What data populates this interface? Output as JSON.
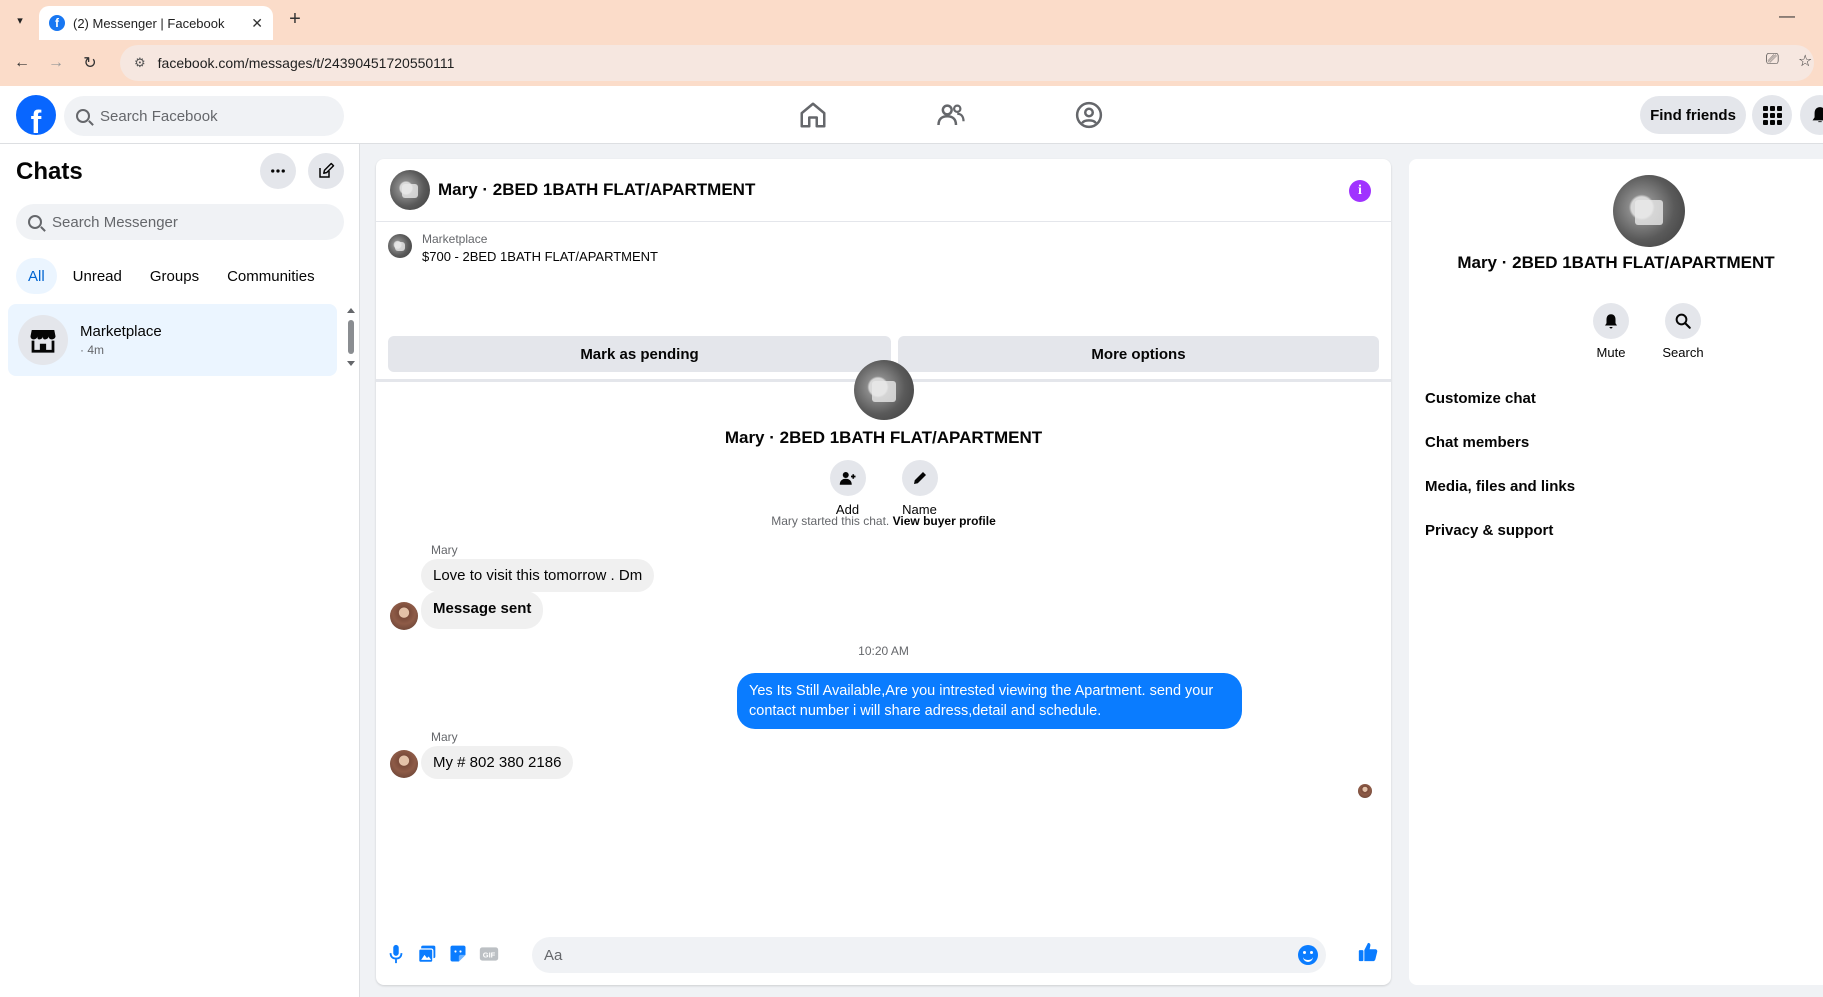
{
  "browser": {
    "tab_title": "(2) Messenger | Facebook",
    "url": "facebook.com/messages/t/24390451720550111"
  },
  "fb_nav": {
    "search_placeholder": "Search Facebook",
    "find_friends": "Find friends"
  },
  "sidebar": {
    "title": "Chats",
    "search_placeholder": "Search Messenger",
    "filters": [
      "All",
      "Unread",
      "Groups",
      "Communities"
    ],
    "active_filter": "All",
    "chats": [
      {
        "name": "Marketplace",
        "sub": "· 4m"
      }
    ]
  },
  "conversation": {
    "title": "Mary · 2BED 1BATH FLAT/APARTMENT",
    "listing": {
      "label": "Marketplace",
      "price_title": "$700 - 2BED 1BATH FLAT/APARTMENT",
      "mark_pending": "Mark as pending",
      "more_options": "More options"
    },
    "intro": {
      "name": "Mary · 2BED 1BATH FLAT/APARTMENT",
      "add_label": "Add",
      "name_label": "Name"
    },
    "system_note": {
      "text": "Mary started this chat. ",
      "link": "View buyer profile"
    },
    "messages": [
      {
        "sender": "Mary",
        "text": "Love to visit this tomorrow . Dm"
      },
      {
        "sender": "Mary",
        "text": "Message sent"
      },
      {
        "timestamp": "10:20 AM"
      },
      {
        "sender": "me",
        "text": "Yes Its Still Available,Are you intrested viewing the Apartment. send your contact number i will share adress,detail and schedule."
      },
      {
        "sender": "Mary",
        "text": "My # 802 380 2186"
      }
    ],
    "composer_placeholder": "Aa"
  },
  "details": {
    "name": "Mary · 2BED 1BATH FLAT/APARTMENT",
    "mute_label": "Mute",
    "search_label": "Search",
    "links": [
      "Customize chat",
      "Chat members",
      "Media, files and links",
      "Privacy & support"
    ]
  },
  "colors": {
    "brand": "#0866ff",
    "outgoing_bubble": "#0a7cff",
    "info_icon": "#a033ff"
  }
}
